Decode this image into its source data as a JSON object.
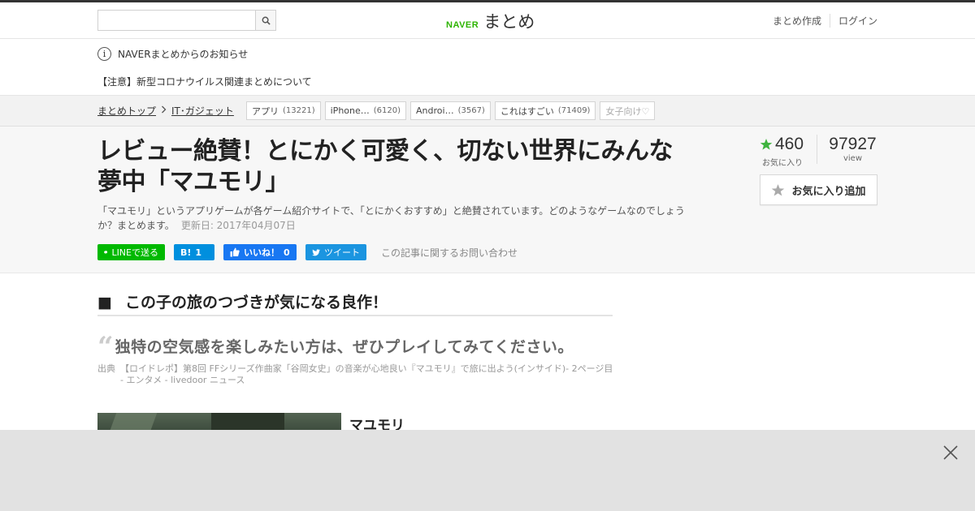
{
  "header": {
    "search_placeholder": "",
    "logo_naver": "NAVER",
    "logo_matome": "まとめ",
    "links": [
      "まとめ作成",
      "ログイン"
    ]
  },
  "notice": {
    "title": "NAVERまとめからのお知らせ",
    "item": "【注意】新型コロナウイルス関連まとめについて"
  },
  "breadcrumb": {
    "items": [
      "まとめトップ",
      "IT･ガジェット"
    ]
  },
  "tags": [
    {
      "label": "アプリ",
      "count": "(13221)"
    },
    {
      "label": "iPhone…",
      "count": "(6120)"
    },
    {
      "label": "Androi…",
      "count": "(3567)"
    },
    {
      "label": "これはすごい",
      "count": "(71409)"
    },
    {
      "label": "女子向け♡",
      "count": ""
    }
  ],
  "article": {
    "title": "レビュー絶賛！とにかく可愛く、切ない世界にみんな夢中「マユモリ」",
    "description": "「マユモリ」というアプリゲームが各ゲーム紹介サイトで、「とにかくおすすめ」と絶賛されています。どのようなゲームなのでしょうか？まとめます。",
    "updated": "更新日: 2017年04月07日"
  },
  "share": {
    "line": "LINEで送る",
    "hatena_count": "1",
    "fb_label": "いいね！",
    "fb_count": "0",
    "tweet": "ツイート",
    "contact": "この記事に関するお問い合わせ"
  },
  "stats": {
    "favorites": "460",
    "favorites_label": "お気に入り",
    "views": "97927",
    "views_label": "view",
    "fav_button": "お気に入り追加"
  },
  "content": {
    "heading_bullet": "■",
    "heading": "この子の旅のつづきが気になる良作！",
    "quote": "独特の空気感を楽しみたい方は、ぜひプレイしてみてください。",
    "source_label": "出典",
    "source": "【ロイドレポ】第8回 FFシリーズ作曲家「谷岡女史」の音楽が心地良い『マユモリ』で旅に出よう(インサイド)- 2ページ目 - エンタメ - livedoor ニュース",
    "item_title": "マユモリ"
  },
  "colors": {
    "naver_green": "#2db400",
    "line_green": "#00b900",
    "hatena_blue": "#008fde",
    "fb_blue": "#1877f2",
    "twitter_blue": "#1b95e0",
    "star_green": "#3fb43f"
  }
}
